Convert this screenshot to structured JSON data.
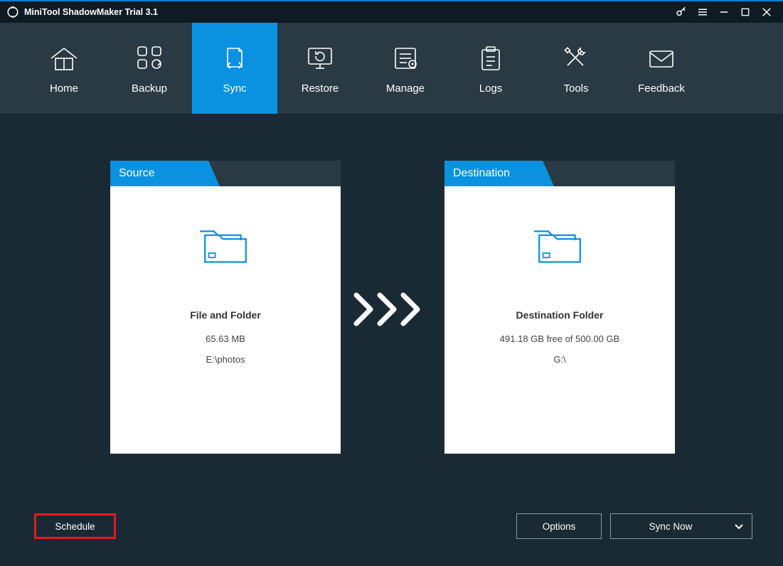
{
  "titlebar": {
    "title": "MiniTool ShadowMaker Trial 3.1"
  },
  "nav": {
    "items": [
      {
        "label": "Home"
      },
      {
        "label": "Backup"
      },
      {
        "label": "Sync"
      },
      {
        "label": "Restore"
      },
      {
        "label": "Manage"
      },
      {
        "label": "Logs"
      },
      {
        "label": "Tools"
      },
      {
        "label": "Feedback"
      }
    ]
  },
  "source": {
    "header": "Source",
    "title": "File and Folder",
    "size": "65.63 MB",
    "path": "E:\\photos"
  },
  "destination": {
    "header": "Destination",
    "title": "Destination Folder",
    "size": "491.18 GB free of 500.00 GB",
    "path": "G:\\"
  },
  "footer": {
    "schedule": "Schedule",
    "options": "Options",
    "syncnow": "Sync Now"
  }
}
